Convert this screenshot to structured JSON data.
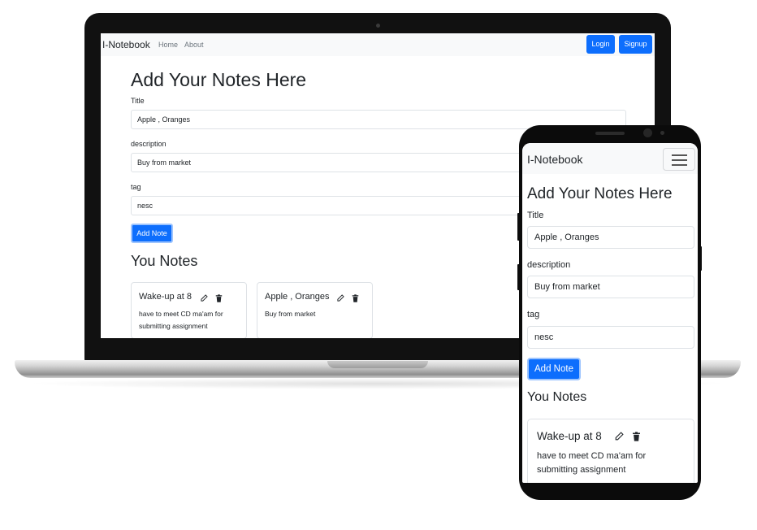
{
  "laptop": {
    "navbar": {
      "brand": "I-Notebook",
      "links": [
        "Home",
        "About"
      ],
      "login_label": "Login",
      "signup_label": "Signup"
    },
    "form": {
      "heading": "Add Your Notes Here",
      "title_label": "Title",
      "title_value": "Apple , Oranges",
      "description_label": "description",
      "description_value": "Buy from market",
      "tag_label": "tag",
      "tag_value": "nesc",
      "submit_label": "Add Note"
    },
    "notes_heading": "You Notes",
    "notes": [
      {
        "title": "Wake-up at 8",
        "description": "have to meet CD ma'am for submitting assignment"
      },
      {
        "title": "Apple , Oranges",
        "description": "Buy from market"
      }
    ]
  },
  "phone": {
    "navbar": {
      "brand": "I-Notebook",
      "menu_icon": "hamburger-menu-icon"
    },
    "form": {
      "heading": "Add Your Notes Here",
      "title_label": "Title",
      "title_value": "Apple , Oranges",
      "description_label": "description",
      "description_value": "Buy from market",
      "tag_label": "tag",
      "tag_value": "nesc",
      "submit_label": "Add Note"
    },
    "notes_heading": "You Notes",
    "notes": [
      {
        "title": "Wake-up at 8",
        "description": "have to meet CD ma'am for submitting assignment"
      }
    ]
  },
  "icons": {
    "edit": "edit-icon",
    "delete": "trash-icon"
  },
  "colors": {
    "primary": "#0d6efd",
    "navbar_bg": "#f8f9fa",
    "text": "#212529",
    "muted": "#6c757d"
  }
}
